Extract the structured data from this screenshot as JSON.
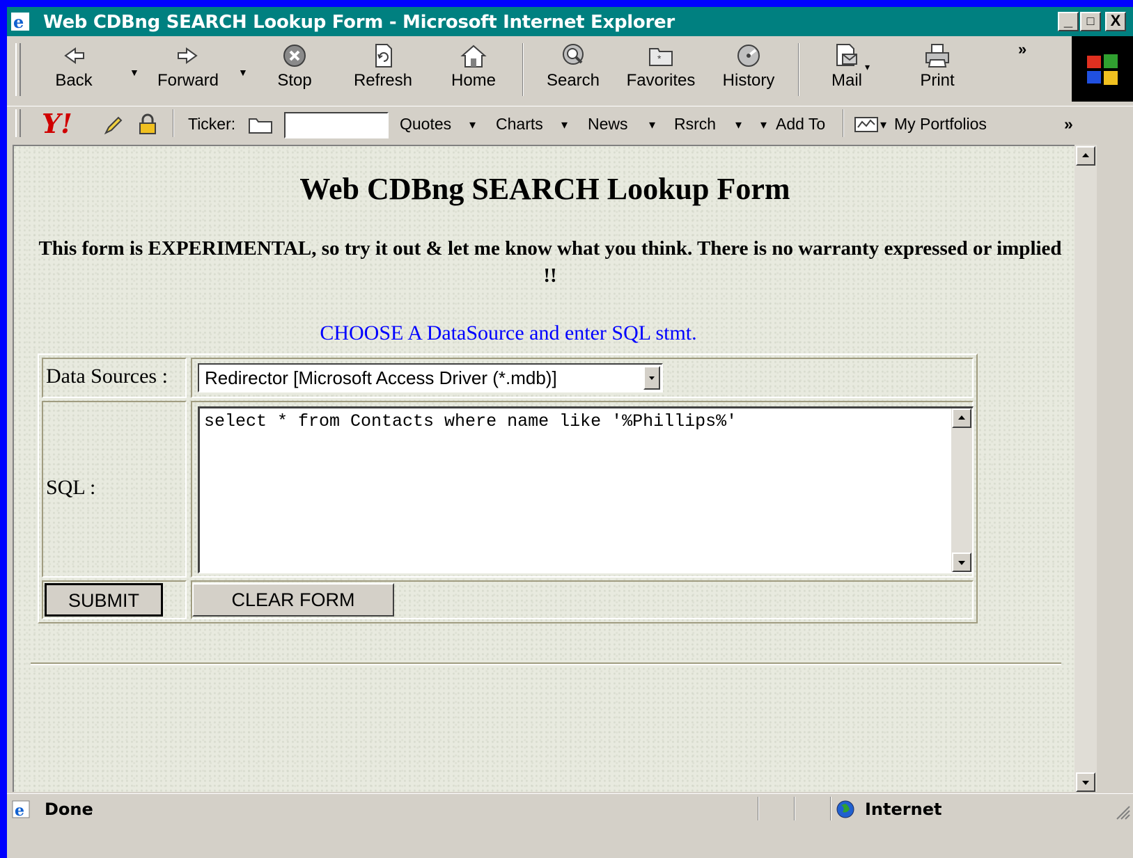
{
  "window": {
    "title": "Web CDBng SEARCH Lookup Form - Microsoft Internet Explorer",
    "min_label": "_",
    "max_label": "□",
    "close_label": "X"
  },
  "toolbar": {
    "back": "Back",
    "forward": "Forward",
    "stop": "Stop",
    "refresh": "Refresh",
    "home": "Home",
    "search": "Search",
    "favorites": "Favorites",
    "history": "History",
    "mail": "Mail",
    "print": "Print",
    "more": "»"
  },
  "yahoo_bar": {
    "logo": "Y!",
    "ticker_label": "Ticker:",
    "ticker_value": "",
    "quotes": "Quotes",
    "charts": "Charts",
    "news": "News",
    "rsrch": "Rsrch",
    "add_to": "Add To",
    "my_portfolios": "My Portfolios",
    "more": "»",
    "dropdown_caret": "▾"
  },
  "page": {
    "title": "Web CDBng SEARCH Lookup Form",
    "note": "This form is EXPERIMENTAL, so try it out & let me know what you think. There is no warranty expressed or implied !!",
    "instruction": "CHOOSE A DataSource and enter SQL stmt.",
    "data_sources_label": "Data Sources :",
    "data_source_selected": "Redirector [Microsoft Access Driver (*.mdb)]",
    "sql_label": "SQL :",
    "sql_value": "select * from Contacts where name like '%Phillips%'",
    "submit_label": "SUBMIT",
    "clear_label": "CLEAR FORM"
  },
  "status": {
    "text": "Done",
    "zone": "Internet"
  },
  "colors": {
    "desktop": "#0000ff",
    "titlebar": "#008080",
    "chrome": "#d4d0c8",
    "link": "#0000ff"
  },
  "icons": [
    "ie-icon",
    "back-arrow-icon",
    "forward-arrow-icon",
    "stop-icon",
    "refresh-icon",
    "home-icon",
    "search-icon",
    "favorites-icon",
    "history-icon",
    "mail-icon",
    "print-icon",
    "windows-logo-icon",
    "yahoo-logo-icon",
    "pencil-icon",
    "lock-icon",
    "folder-icon",
    "portfolio-icon",
    "globe-icon"
  ]
}
